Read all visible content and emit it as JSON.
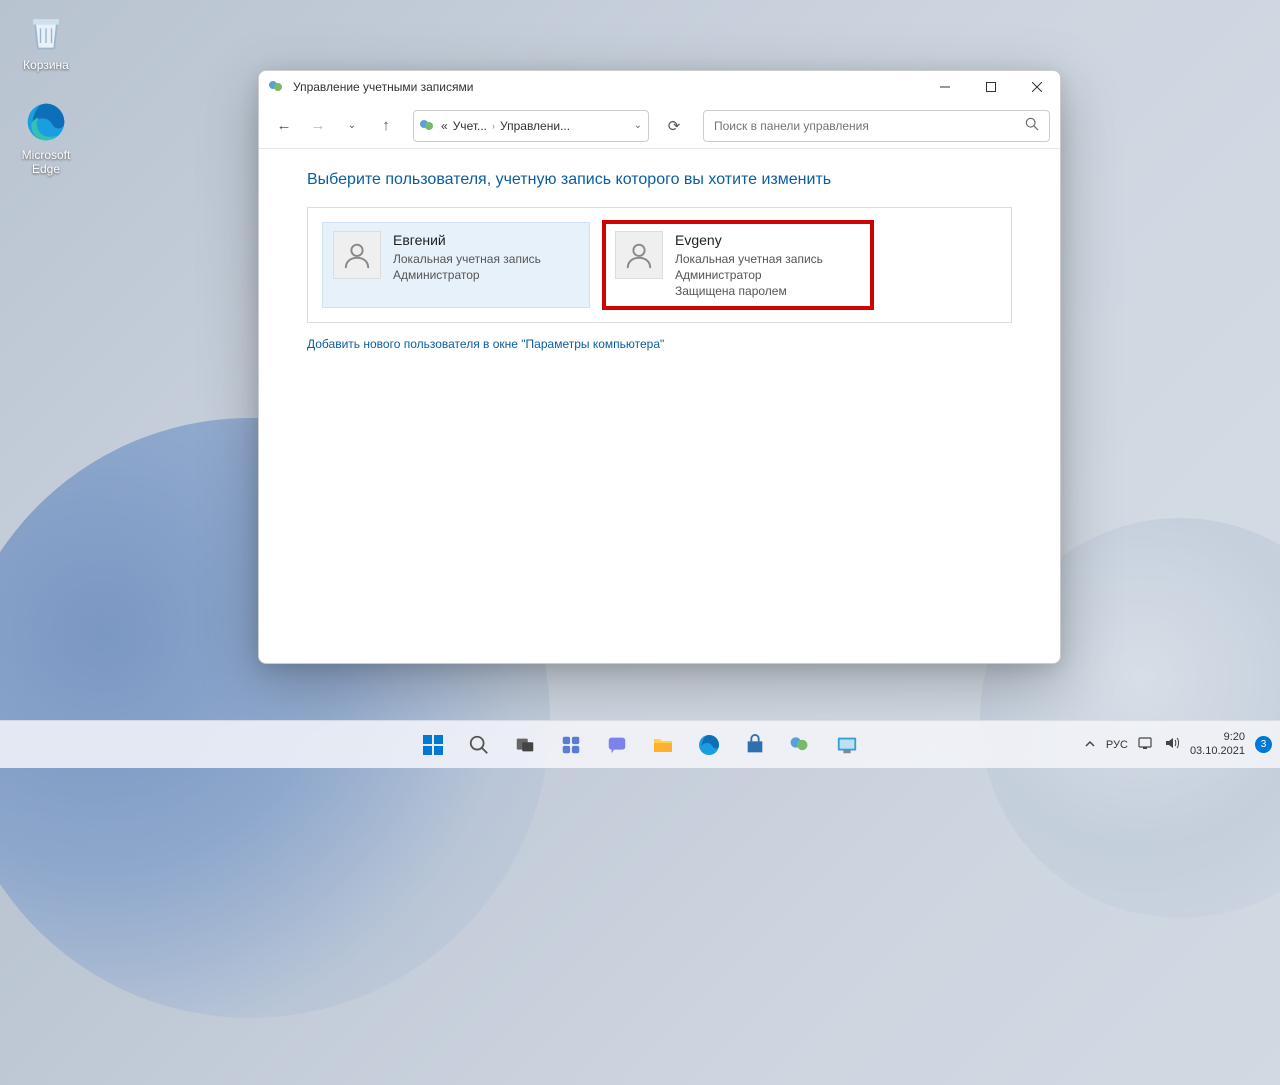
{
  "desktop": {
    "recycle_label": "Корзина",
    "edge_label": "Microsoft Edge"
  },
  "window": {
    "title": "Управление учетными записями",
    "breadcrumb": {
      "prefix": "«",
      "seg1": "Учет...",
      "seg2": "Управлени..."
    },
    "search_placeholder": "Поиск в панели управления",
    "heading": "Выберите пользователя, учетную запись которого вы хотите изменить",
    "users": [
      {
        "name": "Евгений",
        "line1": "Локальная учетная запись",
        "line2": "Администратор",
        "line3": ""
      },
      {
        "name": "Evgeny",
        "line1": "Локальная учетная запись",
        "line2": "Администратор",
        "line3": "Защищена паролем"
      }
    ],
    "add_link": "Добавить нового пользователя в окне \"Параметры компьютера\""
  },
  "taskbar": {
    "lang": "РУС",
    "time": "9:20",
    "date": "03.10.2021",
    "badge": "3"
  }
}
